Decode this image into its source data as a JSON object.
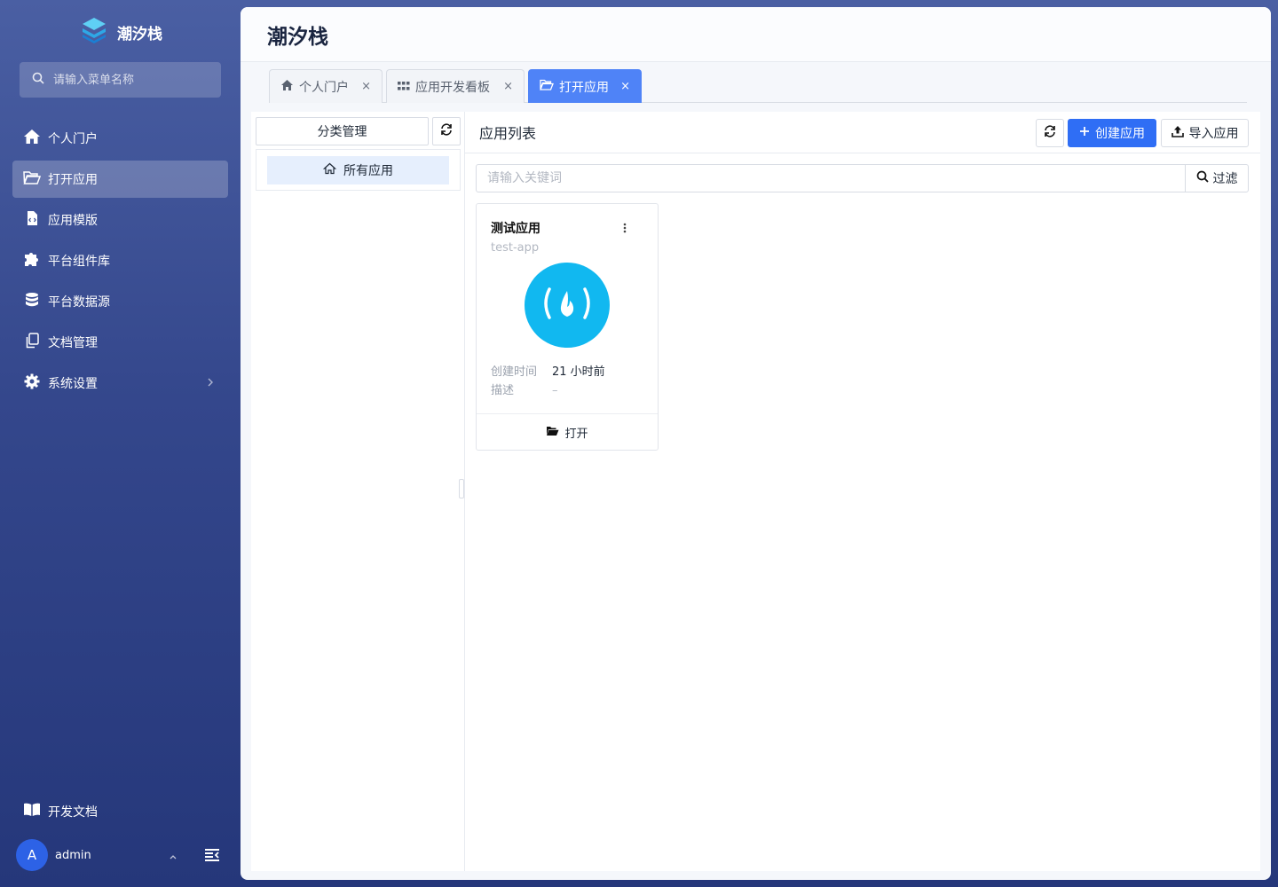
{
  "brand": {
    "name": "潮汐栈"
  },
  "menu_search": {
    "placeholder": "请输入菜单名称"
  },
  "menu": [
    {
      "label": "个人门户",
      "icon": "home-icon",
      "active": false
    },
    {
      "label": "打开应用",
      "icon": "folder-open-icon",
      "active": true
    },
    {
      "label": "应用模版",
      "icon": "file-code-icon",
      "active": false
    },
    {
      "label": "平台组件库",
      "icon": "puzzle-icon",
      "active": false
    },
    {
      "label": "平台数据源",
      "icon": "database-icon",
      "active": false
    },
    {
      "label": "文档管理",
      "icon": "copy-icon",
      "active": false
    },
    {
      "label": "系统设置",
      "icon": "gear-icon",
      "active": false
    }
  ],
  "dev_docs": {
    "label": "开发文档"
  },
  "user": {
    "avatar_letter": "A",
    "name": "admin"
  },
  "page": {
    "title": "潮汐栈"
  },
  "tabs": [
    {
      "label": "个人门户",
      "icon": "home-icon",
      "close": "×",
      "active": false
    },
    {
      "label": "应用开发看板",
      "icon": "grid-icon",
      "close": "×",
      "active": false
    },
    {
      "label": "打开应用",
      "icon": "folder-open-icon",
      "close": "×",
      "active": true
    }
  ],
  "category": {
    "manage_label": "分类管理",
    "all_apps_label": "所有应用"
  },
  "app_list": {
    "title": "应用列表",
    "create_label": "创建应用",
    "import_label": "导入应用",
    "search_placeholder": "请输入关键词",
    "filter_label": "过滤"
  },
  "apps": [
    {
      "name": "测试应用",
      "code": "test-app",
      "created_label": "创建时间",
      "created_value": "21 小时前",
      "desc_label": "描述",
      "desc_value": "–",
      "open_label": "打开"
    }
  ],
  "colors": {
    "accent": "#2f6ef5",
    "tab_active": "#4f83f7",
    "app_logo": "#11b8f0",
    "sidebar_top": "#4a5fa3",
    "sidebar_bottom": "#25377a"
  }
}
